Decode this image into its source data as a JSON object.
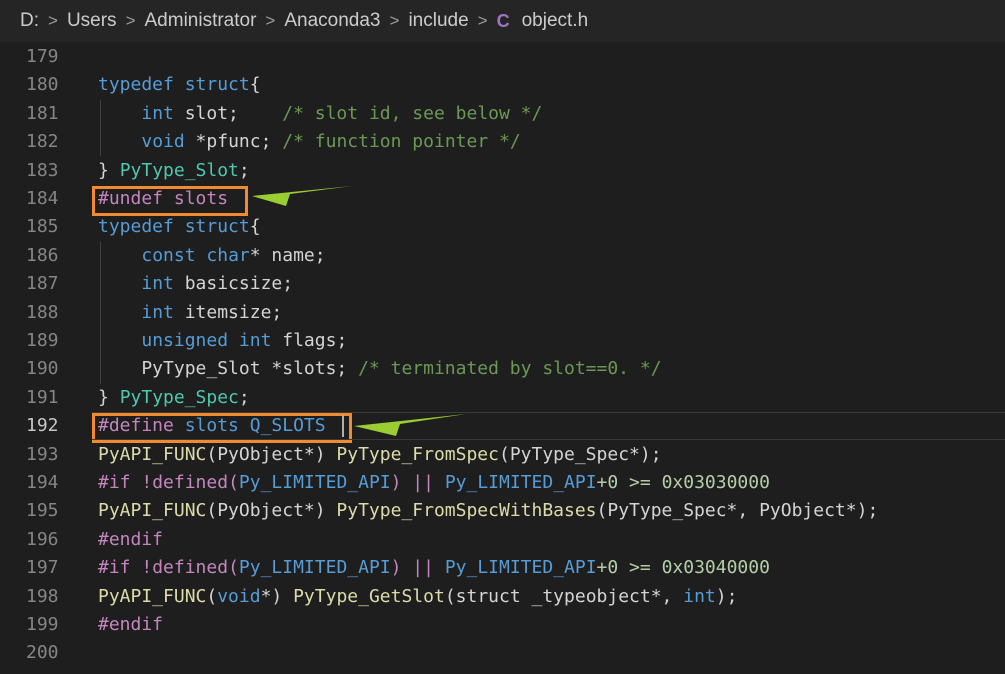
{
  "breadcrumb": {
    "items": [
      "D:",
      "Users",
      "Administrator",
      "Anaconda3",
      "include",
      "object.h"
    ],
    "separator": ">",
    "file_icon_glyph": "C"
  },
  "editor": {
    "lines": [
      {
        "n": "179",
        "tokens": []
      },
      {
        "n": "180",
        "tokens": [
          {
            "t": "typedef",
            "c": "kw"
          },
          {
            "t": " "
          },
          {
            "t": "struct",
            "c": "kw"
          },
          {
            "t": "{"
          }
        ]
      },
      {
        "n": "181",
        "tokens": [
          {
            "t": "    "
          },
          {
            "t": "int",
            "c": "kw"
          },
          {
            "t": " slot;    "
          },
          {
            "t": "/* slot id, see below */",
            "c": "cm"
          }
        ]
      },
      {
        "n": "182",
        "tokens": [
          {
            "t": "    "
          },
          {
            "t": "void",
            "c": "kw"
          },
          {
            "t": " *pfunc; "
          },
          {
            "t": "/* function pointer */",
            "c": "cm"
          }
        ]
      },
      {
        "n": "183",
        "tokens": [
          {
            "t": "} "
          },
          {
            "t": "PyType_Slot",
            "c": "ty"
          },
          {
            "t": ";"
          }
        ]
      },
      {
        "n": "184",
        "tokens": [
          {
            "t": "#undef",
            "c": "pp"
          },
          {
            "t": " "
          },
          {
            "t": "slots",
            "c": "pp"
          }
        ]
      },
      {
        "n": "185",
        "tokens": [
          {
            "t": "typedef",
            "c": "kw"
          },
          {
            "t": " "
          },
          {
            "t": "struct",
            "c": "kw"
          },
          {
            "t": "{"
          }
        ]
      },
      {
        "n": "186",
        "tokens": [
          {
            "t": "    "
          },
          {
            "t": "const",
            "c": "kw"
          },
          {
            "t": " "
          },
          {
            "t": "char",
            "c": "kw"
          },
          {
            "t": "* name;"
          }
        ]
      },
      {
        "n": "187",
        "tokens": [
          {
            "t": "    "
          },
          {
            "t": "int",
            "c": "kw"
          },
          {
            "t": " basicsize;"
          }
        ]
      },
      {
        "n": "188",
        "tokens": [
          {
            "t": "    "
          },
          {
            "t": "int",
            "c": "kw"
          },
          {
            "t": " itemsize;"
          }
        ]
      },
      {
        "n": "189",
        "tokens": [
          {
            "t": "    "
          },
          {
            "t": "unsigned",
            "c": "kw"
          },
          {
            "t": " "
          },
          {
            "t": "int",
            "c": "kw"
          },
          {
            "t": " flags;"
          }
        ]
      },
      {
        "n": "190",
        "tokens": [
          {
            "t": "    PyType_Slot *slots; "
          },
          {
            "t": "/* terminated by slot==0. */",
            "c": "cm"
          }
        ]
      },
      {
        "n": "191",
        "tokens": [
          {
            "t": "} "
          },
          {
            "t": "PyType_Spec",
            "c": "ty"
          },
          {
            "t": ";"
          }
        ]
      },
      {
        "n": "192",
        "tokens": [
          {
            "t": "#define",
            "c": "pp"
          },
          {
            "t": " "
          },
          {
            "t": "slots",
            "c": "mac"
          },
          {
            "t": " "
          },
          {
            "t": "Q_SLOTS",
            "c": "mac"
          }
        ],
        "active": true
      },
      {
        "n": "193",
        "tokens": [
          {
            "t": "PyAPI_FUNC",
            "c": "fn"
          },
          {
            "t": "(PyObject*) "
          },
          {
            "t": "PyType_FromSpec",
            "c": "fn"
          },
          {
            "t": "(PyType_Spec*);"
          }
        ]
      },
      {
        "n": "194",
        "tokens": [
          {
            "t": "#if",
            "c": "pp"
          },
          {
            "t": " !",
            "c": "pp"
          },
          {
            "t": "defined",
            "c": "pp"
          },
          {
            "t": "(",
            "c": "pp"
          },
          {
            "t": "Py_LIMITED_API",
            "c": "mac"
          },
          {
            "t": ")",
            "c": "pp"
          },
          {
            "t": " || ",
            "c": "pp"
          },
          {
            "t": "Py_LIMITED_API",
            "c": "mac"
          },
          {
            "t": "+0 >= 0x03030000",
            "c": "num"
          }
        ]
      },
      {
        "n": "195",
        "tokens": [
          {
            "t": "PyAPI_FUNC",
            "c": "fn"
          },
          {
            "t": "(PyObject*) "
          },
          {
            "t": "PyType_FromSpecWithBases",
            "c": "fn"
          },
          {
            "t": "(PyType_Spec*, PyObject*);"
          }
        ]
      },
      {
        "n": "196",
        "tokens": [
          {
            "t": "#endif",
            "c": "pp"
          }
        ]
      },
      {
        "n": "197",
        "tokens": [
          {
            "t": "#if",
            "c": "pp"
          },
          {
            "t": " !",
            "c": "pp"
          },
          {
            "t": "defined",
            "c": "pp"
          },
          {
            "t": "(",
            "c": "pp"
          },
          {
            "t": "Py_LIMITED_API",
            "c": "mac"
          },
          {
            "t": ")",
            "c": "pp"
          },
          {
            "t": " || ",
            "c": "pp"
          },
          {
            "t": "Py_LIMITED_API",
            "c": "mac"
          },
          {
            "t": "+0 >= 0x03040000",
            "c": "num"
          }
        ]
      },
      {
        "n": "198",
        "tokens": [
          {
            "t": "PyAPI_FUNC",
            "c": "fn"
          },
          {
            "t": "("
          },
          {
            "t": "void",
            "c": "kw"
          },
          {
            "t": "*) "
          },
          {
            "t": "PyType_GetSlot",
            "c": "fn"
          },
          {
            "t": "(struct _typeobject*, "
          },
          {
            "t": "int",
            "c": "kw"
          },
          {
            "t": ");"
          }
        ]
      },
      {
        "n": "199",
        "tokens": [
          {
            "t": "#endif",
            "c": "pp"
          }
        ]
      },
      {
        "n": "200",
        "tokens": []
      }
    ]
  },
  "colors": {
    "highlight_box": "#f28a30",
    "arrow": "#9acd32"
  }
}
